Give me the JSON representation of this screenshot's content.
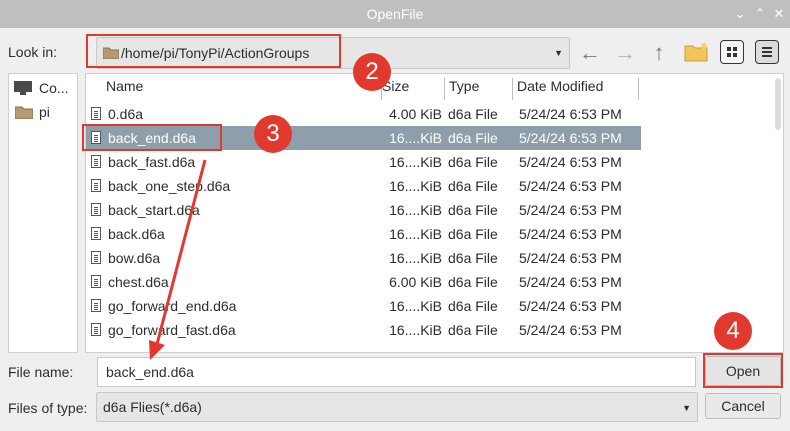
{
  "window": {
    "title": "OpenFile",
    "buttons": [
      "⌄",
      "⌃",
      "✕"
    ]
  },
  "lookin": {
    "label": "Look in:",
    "path": "/home/pi/TonyPi/ActionGroups"
  },
  "sidebar": {
    "items": [
      {
        "label": "Co...",
        "icon": "computer-icon"
      },
      {
        "label": "pi",
        "icon": "folder-icon"
      }
    ]
  },
  "columns": {
    "name": "Name",
    "size": "Size",
    "type": "Type",
    "date": "Date Modified"
  },
  "files": [
    {
      "name": "0.d6a",
      "size": "4.00 KiB",
      "type": "d6a File",
      "date": "5/24/24 6:53 PM"
    },
    {
      "name": "back_end.d6a",
      "size": "16....KiB",
      "type": "d6a File",
      "date": "5/24/24 6:53 PM"
    },
    {
      "name": "back_fast.d6a",
      "size": "16....KiB",
      "type": "d6a File",
      "date": "5/24/24 6:53 PM"
    },
    {
      "name": "back_one_step.d6a",
      "size": "16....KiB",
      "type": "d6a File",
      "date": "5/24/24 6:53 PM"
    },
    {
      "name": "back_start.d6a",
      "size": "16....KiB",
      "type": "d6a File",
      "date": "5/24/24 6:53 PM"
    },
    {
      "name": "back.d6a",
      "size": "16....KiB",
      "type": "d6a File",
      "date": "5/24/24 6:53 PM"
    },
    {
      "name": "bow.d6a",
      "size": "16....KiB",
      "type": "d6a File",
      "date": "5/24/24 6:53 PM"
    },
    {
      "name": "chest.d6a",
      "size": "6.00 KiB",
      "type": "d6a File",
      "date": "5/24/24 6:53 PM"
    },
    {
      "name": "go_forward_end.d6a",
      "size": "16....KiB",
      "type": "d6a File",
      "date": "5/24/24 6:53 PM"
    },
    {
      "name": "go_forward_fast.d6a",
      "size": "16....KiB",
      "type": "d6a File",
      "date": "5/24/24 6:53 PM"
    }
  ],
  "filename": {
    "label": "File name:",
    "value": "back_end.d6a"
  },
  "filetype": {
    "label": "Files of type:",
    "value": "d6a Flies(*.d6a)"
  },
  "buttons": {
    "open": "Open",
    "cancel": "Cancel"
  },
  "annotations": [
    "2",
    "3",
    "4"
  ],
  "colors": {
    "annotation": "#e2392f",
    "selection": "#8e9eab",
    "titlebar": "#bfbfbf"
  }
}
